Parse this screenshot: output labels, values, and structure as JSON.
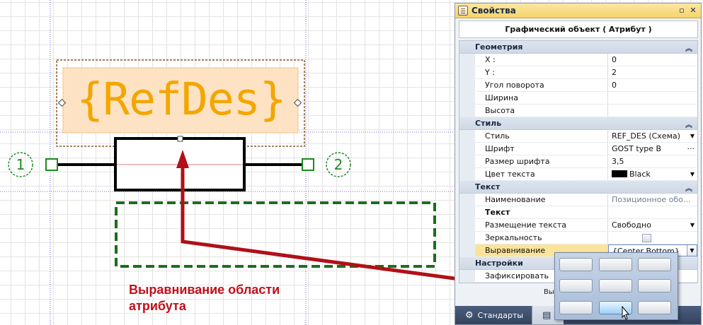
{
  "canvas": {
    "refdes_text": "{RefDes}",
    "pin1_label": "1",
    "pin2_label": "2",
    "callout_line1": "Выравнивание области",
    "callout_line2": "атрибута"
  },
  "panel": {
    "title": "Свойства",
    "object_header": "Графический объект ( Атрибут )",
    "sections": [
      {
        "name": "Геометрия",
        "rows": [
          {
            "label": "X :",
            "value": "0"
          },
          {
            "label": "Y :",
            "value": "2"
          },
          {
            "label": "Угол поворота",
            "value": "0"
          },
          {
            "label": "Ширина",
            "value": ""
          },
          {
            "label": "Высота",
            "value": ""
          }
        ]
      },
      {
        "name": "Стиль",
        "rows": [
          {
            "label": "Стиль",
            "value": "REF_DES (Схема)"
          },
          {
            "label": "Шрифт",
            "value": "GOST type B"
          },
          {
            "label": "Размер шрифта",
            "value": "3,5"
          },
          {
            "label": "Цвет текста",
            "value": "Black"
          }
        ]
      },
      {
        "name": "Текст",
        "rows": [
          {
            "label": "Наименование",
            "value": "Позиционное обо..."
          },
          {
            "label": "Текст",
            "value": ""
          },
          {
            "label": "Размещение текста",
            "value": "Свободно"
          },
          {
            "label": "Зеркальность",
            "value": ""
          },
          {
            "label": "Выравнивание",
            "value": "{Center,Bottom}"
          }
        ]
      },
      {
        "name": "Настройки",
        "rows": [
          {
            "label": "Зафиксировать",
            "value": ""
          }
        ]
      }
    ],
    "partial_label": "Вы",
    "footer_tabs": [
      "Стандарты",
      ""
    ]
  },
  "alignment_popup": {
    "selected": "bottom-center"
  },
  "colors": {
    "refdes_text": "#f3a600",
    "callout": "#c0101a",
    "pin_green": "#1d8a24",
    "arrow_red": "#b01018"
  }
}
